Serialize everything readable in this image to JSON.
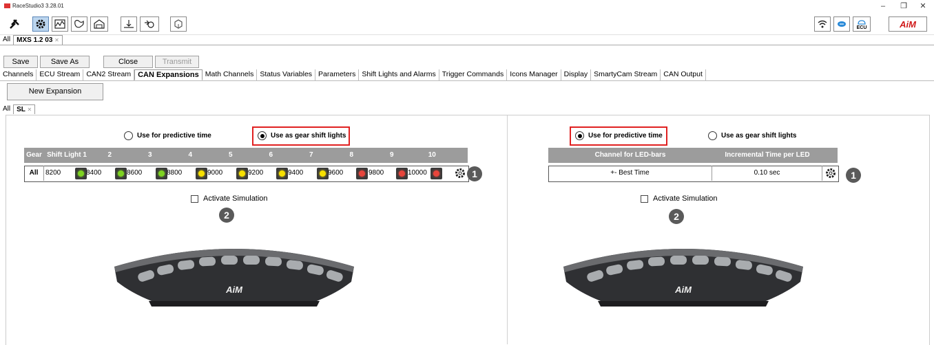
{
  "window": {
    "title": "RaceStudio3 3.28.01",
    "min": "–",
    "max": "❐",
    "close": "✕"
  },
  "toolbar": {
    "left_icons": [
      "wrench-icon",
      "settings-gear-icon",
      "chart-icon",
      "track-icon",
      "garage-icon",
      "graph-upload-icon",
      "download-icon",
      "cube-icon"
    ],
    "right_icons": [
      "wifi-icon",
      "cloud-chat-icon",
      "ecu-icon",
      "aim-logo-icon"
    ],
    "ecu_label": "ECU",
    "brand_label": "AiM",
    "active_color": "#bcd6ef"
  },
  "config_tabs": {
    "all": "All",
    "current": "MXS 1.2 03",
    "close_glyph": "✕"
  },
  "actions": {
    "save": "Save",
    "save_as": "Save As",
    "close": "Close",
    "transmit": "Transmit"
  },
  "main_tabs": [
    "Channels",
    "ECU Stream",
    "CAN2 Stream",
    "CAN Expansions",
    "Math Channels",
    "Status Variables",
    "Parameters",
    "Shift Lights and Alarms",
    "Trigger Commands",
    "Icons Manager",
    "Display",
    "SmartyCam Stream",
    "CAN Output"
  ],
  "main_tab_selected": "CAN Expansions",
  "new_expansion": "New Expansion",
  "exp_tabs": {
    "all": "All",
    "current": "SL",
    "close_glyph": "✕"
  },
  "left": {
    "radio_predictive": "Use for predictive time",
    "radio_gear": "Use as gear shift lights",
    "selected": "gear",
    "headers": [
      "Gear",
      "Shift Light 1",
      "2",
      "3",
      "4",
      "5",
      "6",
      "7",
      "8",
      "9",
      "10"
    ],
    "row_label": "All",
    "values": [
      "8200",
      "8400",
      "8600",
      "8800",
      "9000",
      "9200",
      "9400",
      "9600",
      "9800",
      "10000"
    ],
    "led_colors": [
      "green",
      "green",
      "green",
      "yellow",
      "yellow",
      "yellow",
      "yellow",
      "red",
      "red",
      "red"
    ],
    "badge1": "1",
    "badge2": "2",
    "activate_simulation": "Activate Simulation",
    "device_logo": "AiM"
  },
  "right": {
    "radio_predictive": "Use for predictive time",
    "radio_gear": "Use as gear shift lights",
    "selected": "predictive",
    "headers": [
      "Channel for LED-bars",
      "Incremental Time per LED"
    ],
    "channel": "+- Best Time",
    "increment": "0.10 sec",
    "badge1": "1",
    "badge2": "2",
    "activate_simulation": "Activate Simulation",
    "device_logo": "AiM"
  },
  "colors": {
    "highlight": "#e02020",
    "header": "#9c9c9c",
    "green": "#7ed321",
    "yellow": "#f7e000",
    "red": "#e8453c"
  }
}
